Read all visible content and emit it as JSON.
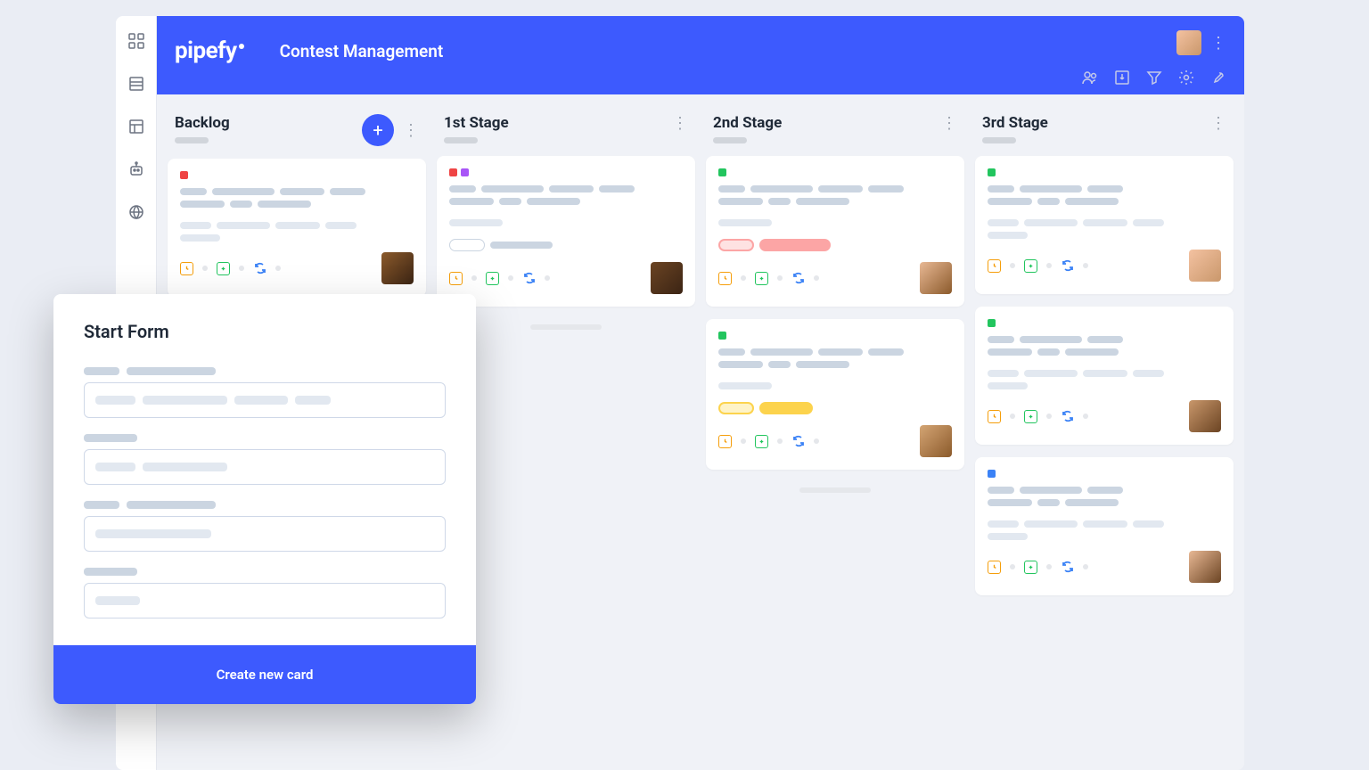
{
  "header": {
    "logo": "pipefy",
    "title": "Contest Management"
  },
  "columns": [
    {
      "title": "Backlog",
      "has_add": true
    },
    {
      "title": "1st Stage",
      "has_add": false
    },
    {
      "title": "2nd Stage",
      "has_add": false
    },
    {
      "title": "3rd Stage",
      "has_add": false
    }
  ],
  "modal": {
    "title": "Start Form",
    "submit": "Create new card"
  },
  "colors": {
    "red": "#ef4444",
    "purple": "#a855f7",
    "green": "#22c55e",
    "blue": "#3b82f6",
    "orange": "#f59e0b"
  }
}
